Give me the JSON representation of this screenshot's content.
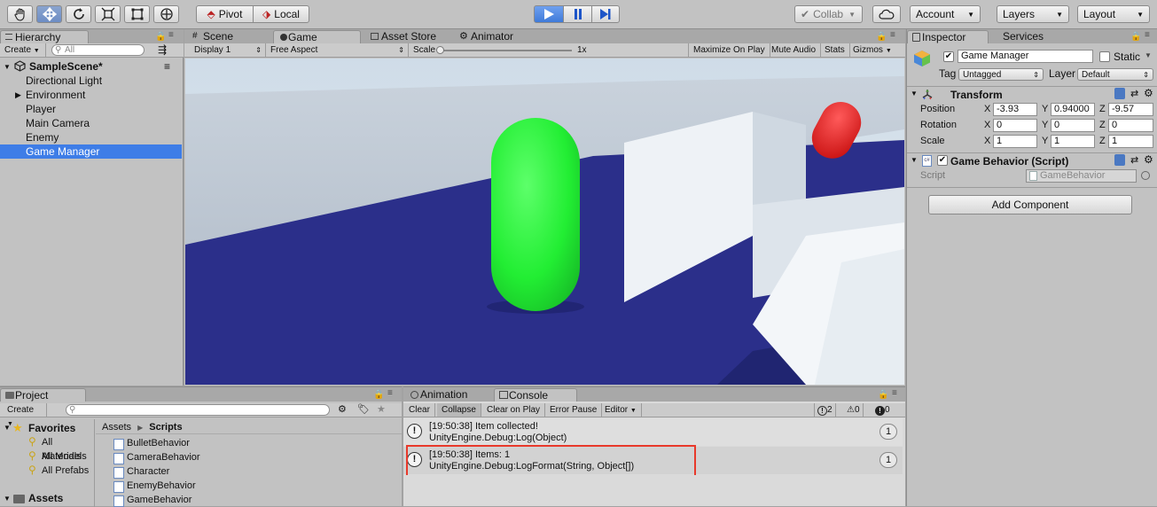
{
  "toolbar": {
    "tools": [
      "hand-tool-icon",
      "move-tool-icon",
      "rotate-tool-icon",
      "scale-tool-icon",
      "rect-tool-icon",
      "transform-tool-icon"
    ],
    "pivot": "Pivot",
    "local": "Local",
    "collab": "Collab",
    "account": "Account",
    "layers": "Layers",
    "layout": "Layout"
  },
  "hierarchy": {
    "tab": "Hierarchy",
    "create": "Create",
    "search_placeholder": "All",
    "scene": "SampleScene*",
    "items": [
      "Directional Light",
      "Environment",
      "Player",
      "Main Camera",
      "Enemy",
      "Game Manager"
    ],
    "selected": "Game Manager"
  },
  "center_tabs": {
    "scene": "Scene",
    "game": "Game",
    "asset_store": "Asset Store",
    "animator": "Animator"
  },
  "game_bar": {
    "display": "Display 1",
    "aspect": "Free Aspect",
    "scale_label": "Scale",
    "scale_value": "1x",
    "maximize": "Maximize On Play",
    "mute": "Mute Audio",
    "stats": "Stats",
    "gizmos": "Gizmos"
  },
  "inspector": {
    "tab": "Inspector",
    "services_tab": "Services",
    "object_name": "Game Manager",
    "static_label": "Static",
    "tag_label": "Tag",
    "tag_value": "Untagged",
    "layer_label": "Layer",
    "layer_value": "Default",
    "transform_title": "Transform",
    "position_label": "Position",
    "rotation_label": "Rotation",
    "scale_label": "Scale",
    "x": "X",
    "y": "Y",
    "z": "Z",
    "position": [
      "-3.93",
      "0.94000",
      "-9.57"
    ],
    "rotation": [
      "0",
      "0",
      "0"
    ],
    "scale": [
      "1",
      "1",
      "1"
    ],
    "script_component_title": "Game Behavior (Script)",
    "script_label": "Script",
    "script_value": "GameBehavior",
    "add_component": "Add Component"
  },
  "project": {
    "tab": "Project",
    "create": "Create",
    "favorites": "Favorites",
    "favorites_items": [
      "All Materials",
      "All Models",
      "All Prefabs"
    ],
    "assets_root": "Assets",
    "breadcrumb_root": "Assets",
    "breadcrumb_current": "Scripts",
    "files": [
      "BulletBehavior",
      "CameraBehavior",
      "Character",
      "EnemyBehavior",
      "GameBehavior"
    ]
  },
  "console": {
    "animation_tab": "Animation",
    "tab": "Console",
    "clear": "Clear",
    "collapse": "Collapse",
    "clear_on_play": "Clear on Play",
    "error_pause": "Error Pause",
    "editor": "Editor",
    "counts": [
      "2",
      "0",
      "0"
    ],
    "entries": [
      {
        "line1": "[19:50:38] Item collected!",
        "line2": "UnityEngine.Debug:Log(Object)",
        "count": "1"
      },
      {
        "line1": "[19:50:38] Items: 1",
        "line2": "UnityEngine.Debug:LogFormat(String, Object[])",
        "count": "1"
      }
    ]
  },
  "colors": {
    "highlight_box": "#e8392b",
    "selection": "#3e7de7",
    "player_capsule": "#22ee33",
    "enemy_capsule": "#e01a1a",
    "ground": "#2b2f8a"
  }
}
